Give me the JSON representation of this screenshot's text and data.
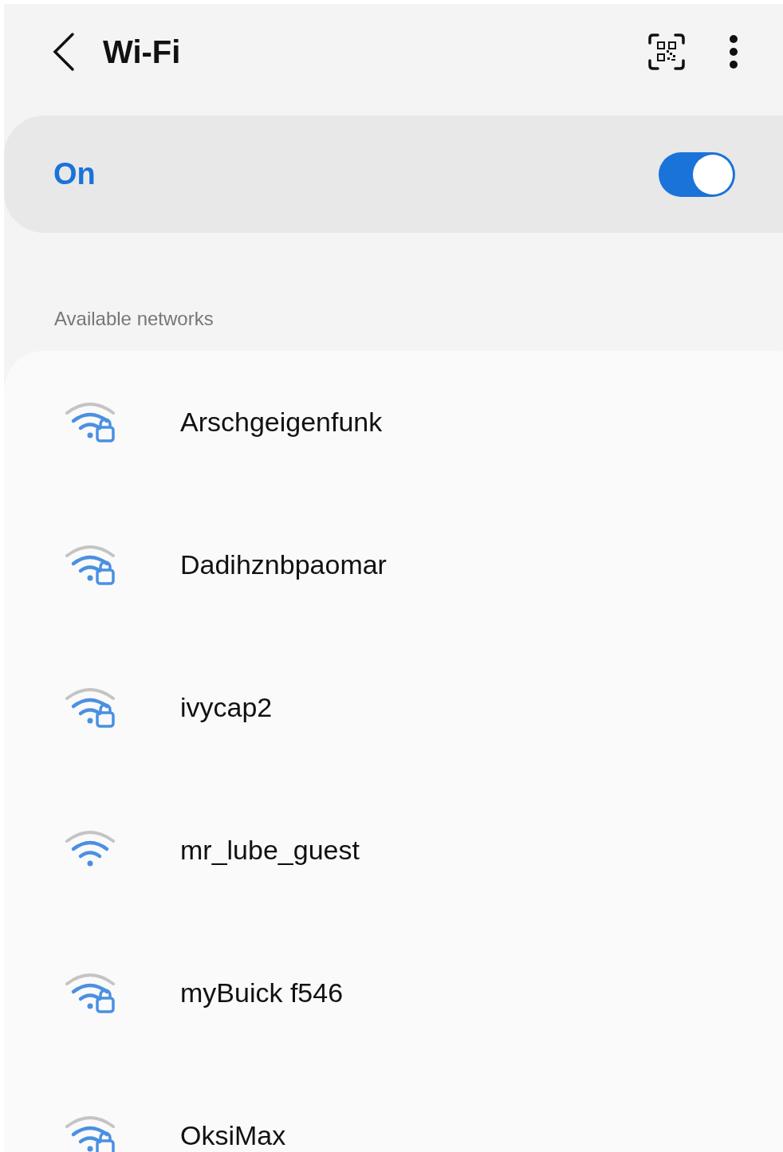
{
  "header": {
    "title": "Wi-Fi"
  },
  "master_switch": {
    "label": "On",
    "on": true
  },
  "section_title": "Available networks",
  "networks": [
    {
      "name": "Arschgeigenfunk",
      "secured": true
    },
    {
      "name": "Dadihznbpaomar",
      "secured": true
    },
    {
      "name": "ivycap2",
      "secured": true
    },
    {
      "name": "mr_lube_guest",
      "secured": false
    },
    {
      "name": "myBuick f546",
      "secured": true
    },
    {
      "name": "OksiMax",
      "secured": true
    }
  ]
}
